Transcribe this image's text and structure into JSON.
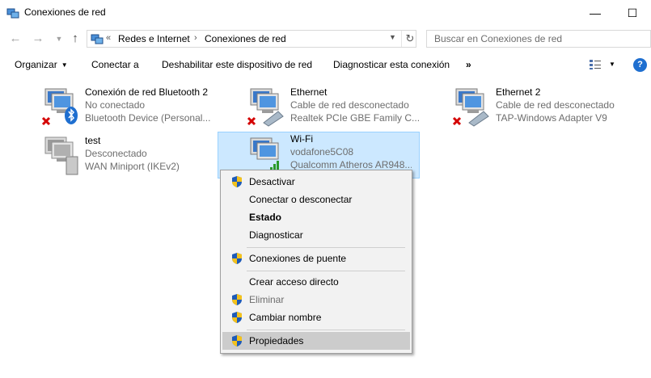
{
  "window": {
    "title": "Conexiones de red",
    "minimize": "—",
    "maximize": "☐"
  },
  "address": {
    "overflow": "«",
    "crumbs": [
      "Redes e Internet",
      "Conexiones de red"
    ],
    "separator": "›",
    "search_placeholder": "Buscar en Conexiones de red"
  },
  "toolbar": {
    "organize": "Organizar",
    "connect": "Conectar a",
    "disable": "Deshabilitar este dispositivo de red",
    "diagnose": "Diagnosticar esta conexión",
    "more": "»"
  },
  "connections": [
    {
      "name": "Conexión de red Bluetooth 2",
      "status": "No conectado",
      "device": "Bluetooth Device (Personal...",
      "icon": "bluetooth-adapter-icon",
      "error": true
    },
    {
      "name": "Ethernet",
      "status": "Cable de red desconectado",
      "device": "Realtek PCIe GBE Family C...",
      "icon": "ethernet-adapter-icon",
      "error": true
    },
    {
      "name": "Ethernet 2",
      "status": "Cable de red desconectado",
      "device": "TAP-Windows Adapter V9",
      "icon": "ethernet-adapter-icon",
      "error": true
    },
    {
      "name": "test",
      "status": "Desconectado",
      "device": "WAN Miniport (IKEv2)",
      "icon": "vpn-adapter-icon",
      "error": false
    },
    {
      "name": "Wi-Fi",
      "status": "vodafone5C08",
      "device": "Qualcomm Atheros AR948...",
      "icon": "wifi-adapter-icon",
      "error": false,
      "selected": true
    }
  ],
  "context_menu": {
    "items": [
      {
        "label": "Desactivar",
        "shield": true
      },
      {
        "label": "Conectar o desconectar",
        "shield": false
      },
      {
        "label": "Estado",
        "shield": false,
        "bold": true
      },
      {
        "label": "Diagnosticar",
        "shield": false
      },
      {
        "label": "Conexiones de puente",
        "shield": true
      },
      {
        "label": "Crear acceso directo",
        "shield": false
      },
      {
        "label": "Eliminar",
        "shield": true,
        "disabled": true
      },
      {
        "label": "Cambiar nombre",
        "shield": true
      },
      {
        "label": "Propiedades",
        "shield": true,
        "highlighted": true
      }
    ]
  },
  "colors": {
    "selection": "#cce8ff",
    "menu_bg": "#f2f2f2",
    "menu_hover": "#cccccc",
    "muted_text": "#6d6d6d",
    "error_red": "#d40000"
  }
}
